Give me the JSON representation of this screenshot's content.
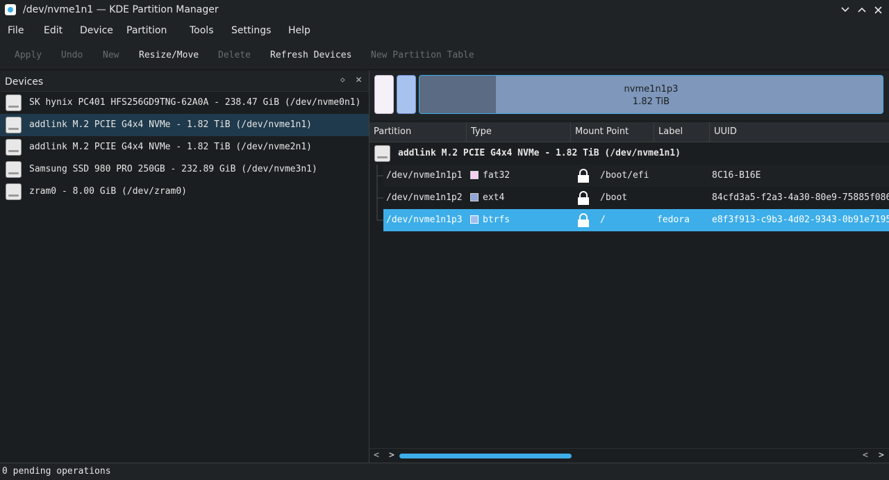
{
  "window": {
    "title": "/dev/nvme1n1 — KDE Partition Manager",
    "icon": "partition-manager-icon"
  },
  "menu": [
    "File",
    "Edit",
    "Device",
    "Partition",
    "Tools",
    "Settings",
    "Help"
  ],
  "toolbar": [
    {
      "label": "Apply",
      "enabled": false
    },
    {
      "label": "Undo",
      "enabled": false
    },
    {
      "label": "New",
      "enabled": false
    },
    {
      "label": "Resize/Move",
      "enabled": true
    },
    {
      "label": "Delete",
      "enabled": false
    },
    {
      "label": "Refresh Devices",
      "enabled": true
    },
    {
      "label": "New Partition Table",
      "enabled": false
    }
  ],
  "devices_panel": {
    "title": "Devices",
    "items": [
      {
        "label": "SK hynix PC401 HFS256GD9TNG-62A0A - 238.47 GiB (/dev/nvme0n1)",
        "selected": false
      },
      {
        "label": "addlink M.2 PCIE G4x4 NVMe - 1.82 TiB (/dev/nvme1n1)",
        "selected": true
      },
      {
        "label": "addlink M.2 PCIE G4x4 NVMe - 1.82 TiB (/dev/nvme2n1)",
        "selected": false
      },
      {
        "label": "Samsung SSD 980 PRO 250GB - 232.89 GiB (/dev/nvme3n1)",
        "selected": false
      },
      {
        "label": "zram0 - 8.00 GiB (/dev/zram0)",
        "selected": false
      }
    ]
  },
  "partition_bar": {
    "selected_name": "nvme1n1p3",
    "selected_size": "1.82 TiB"
  },
  "partition_table": {
    "columns": [
      "Partition",
      "Type",
      "Mount Point",
      "Label",
      "UUID"
    ],
    "device_row": "addlink M.2 PCIE G4x4 NVMe - 1.82 TiB (/dev/nvme1n1)",
    "rows": [
      {
        "partition": "/dev/nvme1n1p1",
        "type": "fat32",
        "color": "#f5d0f0",
        "mount": "/boot/efi",
        "label": "",
        "uuid": "8C16-B16E",
        "selected": false
      },
      {
        "partition": "/dev/nvme1n1p2",
        "type": "ext4",
        "color": "#8fa6d6",
        "mount": "/boot",
        "label": "",
        "uuid": "84cfd3a5-f2a3-4a30-80e9-75885f086",
        "selected": false
      },
      {
        "partition": "/dev/nvme1n1p3",
        "type": "btrfs",
        "color": "#9fbfee",
        "mount": "/",
        "label": "fedora",
        "uuid": "e8f3f913-c9b3-4d02-9343-0b91e7195",
        "selected": true
      }
    ]
  },
  "status": "0 pending operations",
  "colors": {
    "accent": "#3daee9",
    "background": "#1b1e20",
    "selected_device": "#1f3a4c"
  }
}
